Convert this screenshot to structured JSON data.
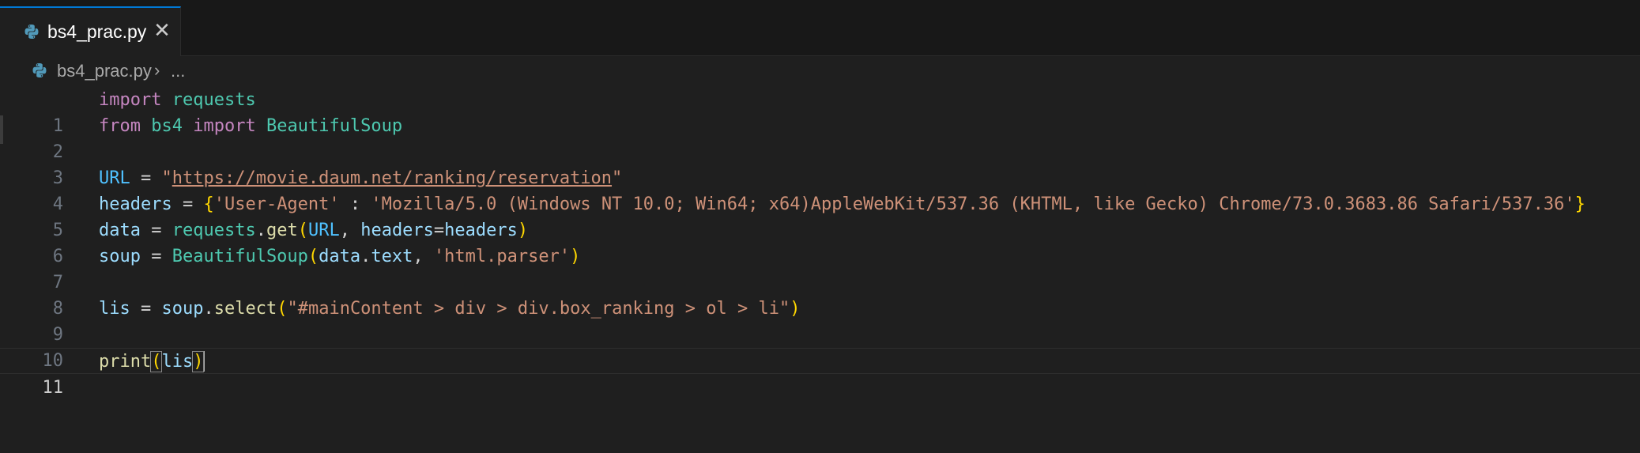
{
  "tab": {
    "label": "bs4_prac.py",
    "close_symbol": "✕",
    "icon": "python-icon"
  },
  "breadcrumb": {
    "file": "bs4_prac.py",
    "separator": "›",
    "more": "..."
  },
  "editor": {
    "current_line": 11,
    "lines": [
      {
        "num": "1"
      },
      {
        "num": "2"
      },
      {
        "num": "3"
      },
      {
        "num": "4"
      },
      {
        "num": "5"
      },
      {
        "num": "6"
      },
      {
        "num": "7"
      },
      {
        "num": "8"
      },
      {
        "num": "9"
      },
      {
        "num": "10"
      },
      {
        "num": "11"
      }
    ],
    "tokens": {
      "import": "import",
      "from": "from",
      "requests": "requests",
      "bs4": "bs4",
      "BeautifulSoup": "BeautifulSoup",
      "URL": "URL",
      "eq": " = ",
      "url_q1": "\"",
      "url_value": "https://movie.daum.net/ranking/reservation",
      "url_q2": "\"",
      "headers": "headers",
      "ua_key": "'User-Agent'",
      "colon": " : ",
      "ua_value": "'Mozilla/5.0 (Windows NT 10.0; Win64; x64)AppleWebKit/537.36 (KHTML, like Gecko) Chrome/73.0.3683.86 Safari/537.36'",
      "data": "data",
      "get": "get",
      "headers_kw": "headers",
      "soup": "soup",
      "text_attr": "text",
      "parser_str": "'html.parser'",
      "lis": "lis",
      "select": "select",
      "selector_str": "\"#mainContent > div > div.box_ranking > ol > li\"",
      "print": "print"
    }
  },
  "colors": {
    "keyword": "#c586c0",
    "module": "#4ec9b0",
    "variable": "#9cdcfe",
    "string": "#ce9178",
    "function": "#dcdcaa",
    "accent": "#0078d4"
  }
}
